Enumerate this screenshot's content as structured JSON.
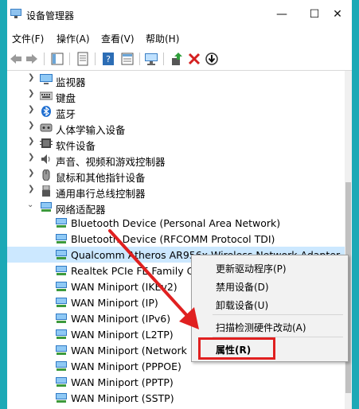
{
  "window": {
    "title": "设备管理器",
    "min_glyph": "—",
    "max_glyph": "☐",
    "close_glyph": "✕"
  },
  "menu": [
    "文件(F)",
    "操作(A)",
    "查看(V)",
    "帮助(H)"
  ],
  "tree": {
    "categories": [
      {
        "label": "监视器",
        "icon": "monitor-icon"
      },
      {
        "label": "键盘",
        "icon": "keyboard-icon"
      },
      {
        "label": "蓝牙",
        "icon": "bluetooth-icon"
      },
      {
        "label": "人体学输入设备",
        "icon": "hid-icon"
      },
      {
        "label": "软件设备",
        "icon": "software-device-icon"
      },
      {
        "label": "声音、视频和游戏控制器",
        "icon": "sound-icon"
      },
      {
        "label": "鼠标和其他指针设备",
        "icon": "mouse-icon"
      },
      {
        "label": "通用串行总线控制器",
        "icon": "usb-icon"
      },
      {
        "label": "网络适配器",
        "icon": "network-icon"
      }
    ],
    "adapters": [
      "Bluetooth Device (Personal Area Network)",
      "Bluetooth Device (RFCOMM Protocol TDI)",
      "Qualcomm Atheros AR956x Wireless Network Adapter",
      "Realtek PCIe FE Family Co",
      "WAN Miniport (IKEv2)",
      "WAN Miniport (IP)",
      "WAN Miniport (IPv6)",
      "WAN Miniport (L2TP)",
      "WAN Miniport (Network",
      "WAN Miniport (PPPOE)",
      "WAN Miniport (PPTP)",
      "WAN Miniport (SSTP)"
    ]
  },
  "context_menu": {
    "update_driver": "更新驱动程序(P)",
    "disable": "禁用设备(D)",
    "uninstall": "卸载设备(U)",
    "scan": "扫描检测硬件改动(A)",
    "properties": "属性(R)"
  },
  "colors": {
    "accent": "#1ca9b6",
    "selection": "#cce8ff",
    "annotation": "#e02020"
  }
}
